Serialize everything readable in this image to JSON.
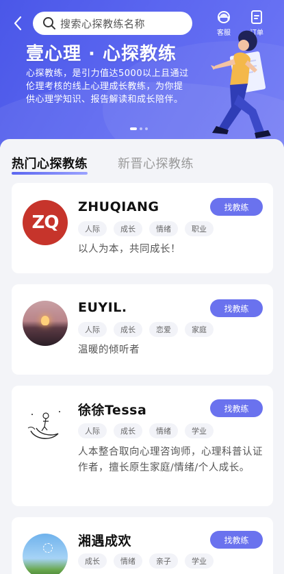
{
  "header": {
    "search_placeholder": "搜索心探教练名称",
    "kefu_label": "客服",
    "order_label": "订单"
  },
  "banner": {
    "title": "壹心理 · 心探教练",
    "description": "心探教练，是引力值达5000以上且通过伦理考核的线上心理成长教练，为你提供心理学知识、报告解读和成长陪伴。",
    "slides_total": 3,
    "slide_active": 1
  },
  "tabs": [
    {
      "label": "热门心探教练",
      "active": true
    },
    {
      "label": "新晋心探教练",
      "active": false
    }
  ],
  "colors": {
    "brand": "#5b66f0",
    "button": "#6a72ee",
    "tag_bg": "#f2f3f8"
  },
  "coaches": [
    {
      "name": "ZHUQIANG",
      "avatar_text": "ZQ",
      "tags": [
        "人际",
        "成长",
        "情绪",
        "职业"
      ],
      "description": "以人为本，共同成长！",
      "button": "找教练"
    },
    {
      "name": "EUYIL.",
      "tags": [
        "人际",
        "成长",
        "恋爱",
        "家庭"
      ],
      "description": "温暖的倾听者",
      "button": "找教练"
    },
    {
      "name": "徐徐Tessa",
      "tags": [
        "人际",
        "成长",
        "情绪",
        "学业"
      ],
      "description": "人本整合取向心理咨询师，心理科普认证作者，擅长原生家庭/情绪/个人成长。",
      "button": "找教练"
    },
    {
      "name": "湘遇成欢",
      "tags": [
        "成长",
        "情绪",
        "亲子",
        "学业"
      ],
      "description": "",
      "button": "找教练"
    }
  ]
}
